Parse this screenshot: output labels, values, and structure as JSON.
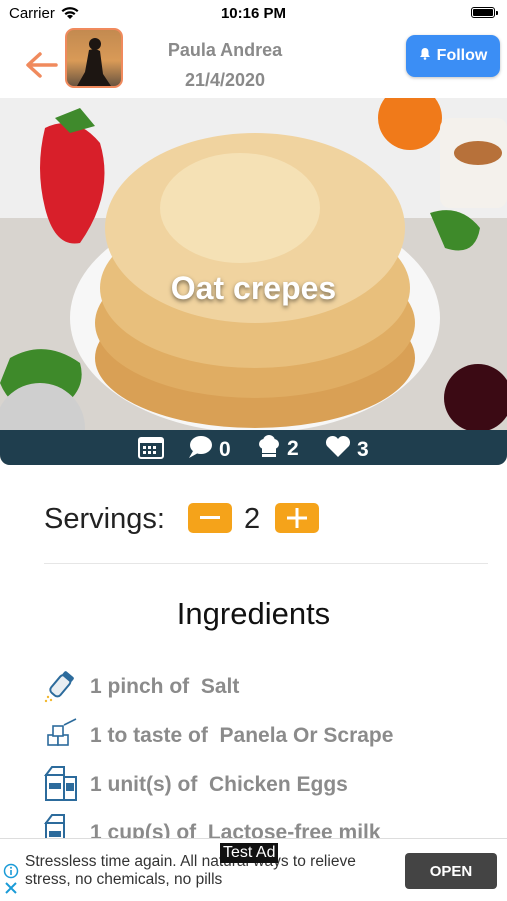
{
  "status_bar": {
    "carrier": "Carrier",
    "time": "10:16 PM"
  },
  "header": {
    "author": "Paula Andrea",
    "date": "21/4/2020",
    "follow_label": "Follow"
  },
  "recipe": {
    "title": "Oat crepes",
    "stats": {
      "comments": "0",
      "chefs": "2",
      "likes": "3"
    }
  },
  "servings": {
    "label": "Servings:",
    "count": "2"
  },
  "ingredients": {
    "title": "Ingredients",
    "items": [
      {
        "text": "1 pinch of  Salt",
        "icon": "salt-shaker-icon"
      },
      {
        "text": "1 to taste of  Panela Or Scrape",
        "icon": "sugar-cubes-icon"
      },
      {
        "text": "1 unit(s) of  Chicken Eggs",
        "icon": "carton-icon"
      },
      {
        "text": "1 cup(s) of  Lactose-free milk",
        "icon": "carton-icon"
      }
    ]
  },
  "ad": {
    "badge": "Test Ad",
    "text": "Stressless time again. All natural ways to relieve stress, no chemicals, no pills",
    "open_label": "OPEN"
  },
  "colors": {
    "accent_orange": "#f5a31a",
    "follow_blue": "#3b8ef5",
    "stats_bar": "#1f3e4e",
    "back_arrow": "#f08a5d"
  }
}
